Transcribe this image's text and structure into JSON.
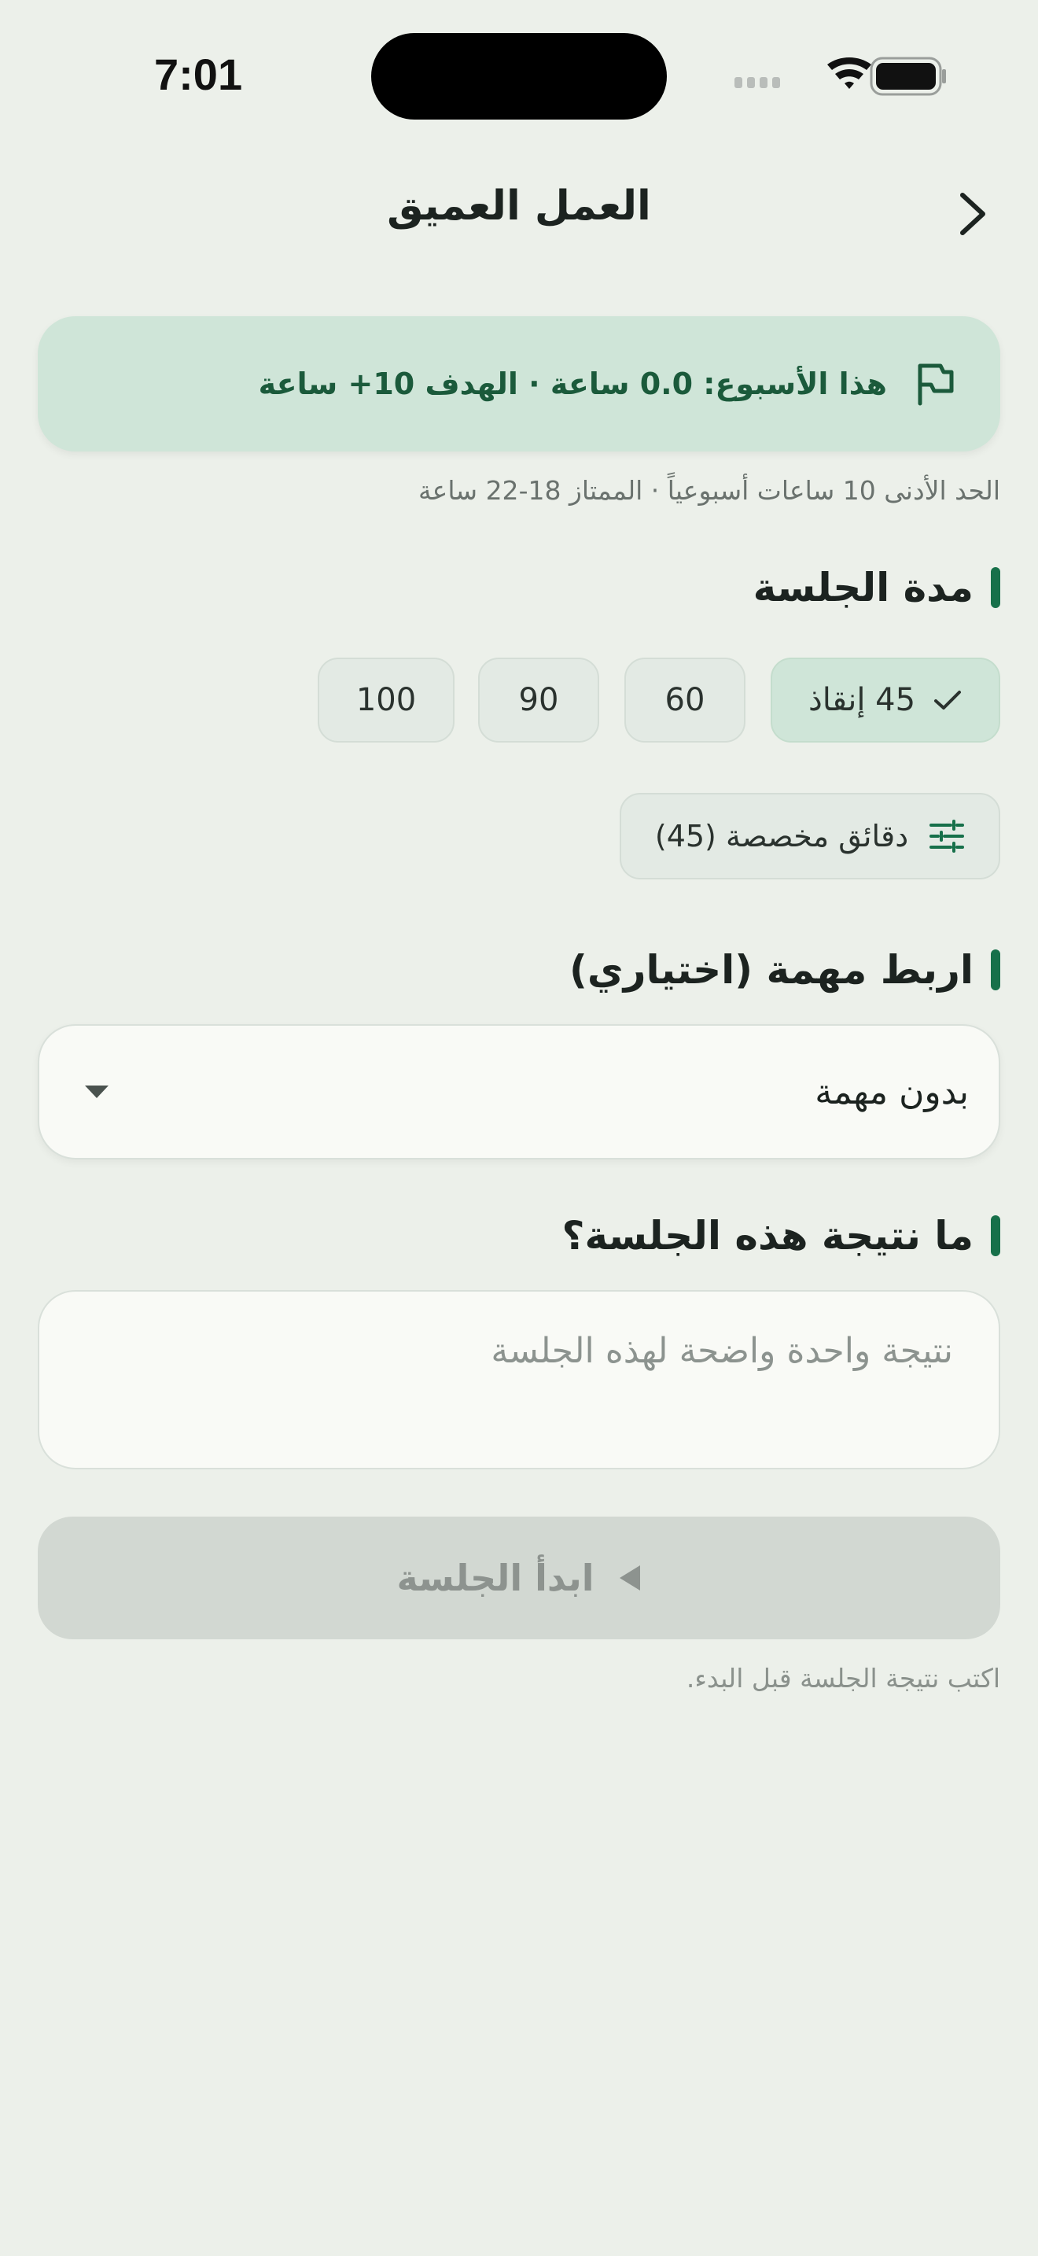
{
  "status_bar": {
    "time": "7:01"
  },
  "header": {
    "title": "العمل العميق"
  },
  "banner": {
    "text": "هذا الأسبوع: 0.0 ساعة · الهدف 10+ ساعة"
  },
  "banner_note": "الحد الأدنى 10 ساعات أسبوعياً · الممتاز 18-22 ساعة",
  "duration": {
    "section_title": "مدة الجلسة",
    "options": [
      {
        "label": "45 إنقاذ",
        "selected": true
      },
      {
        "label": "60",
        "selected": false
      },
      {
        "label": "90",
        "selected": false
      },
      {
        "label": "100",
        "selected": false
      }
    ],
    "custom_label": "دقائق مخصصة (45)"
  },
  "task": {
    "section_title": "اربط مهمة (اختياري)",
    "selected_value": "بدون مهمة"
  },
  "outcome": {
    "section_title": "ما نتيجة هذه الجلسة؟",
    "placeholder": "نتيجة واحدة واضحة لهذه الجلسة",
    "value": ""
  },
  "start": {
    "label": "ابدأ الجلسة",
    "hint": "اكتب نتيجة الجلسة قبل البدء."
  },
  "colors": {
    "accent": "#17704A",
    "background": "#ECF0EA",
    "banner_bg": "#CFE5D8",
    "banner_text": "#1B5A3B",
    "disabled_button": "#D2D8D2"
  },
  "icons": {
    "back": "chevron-right-icon",
    "banner": "flag-icon",
    "selected_chip": "check-icon",
    "custom": "tune-sliders-icon",
    "dropdown": "caret-down-icon",
    "start": "play-icon"
  }
}
